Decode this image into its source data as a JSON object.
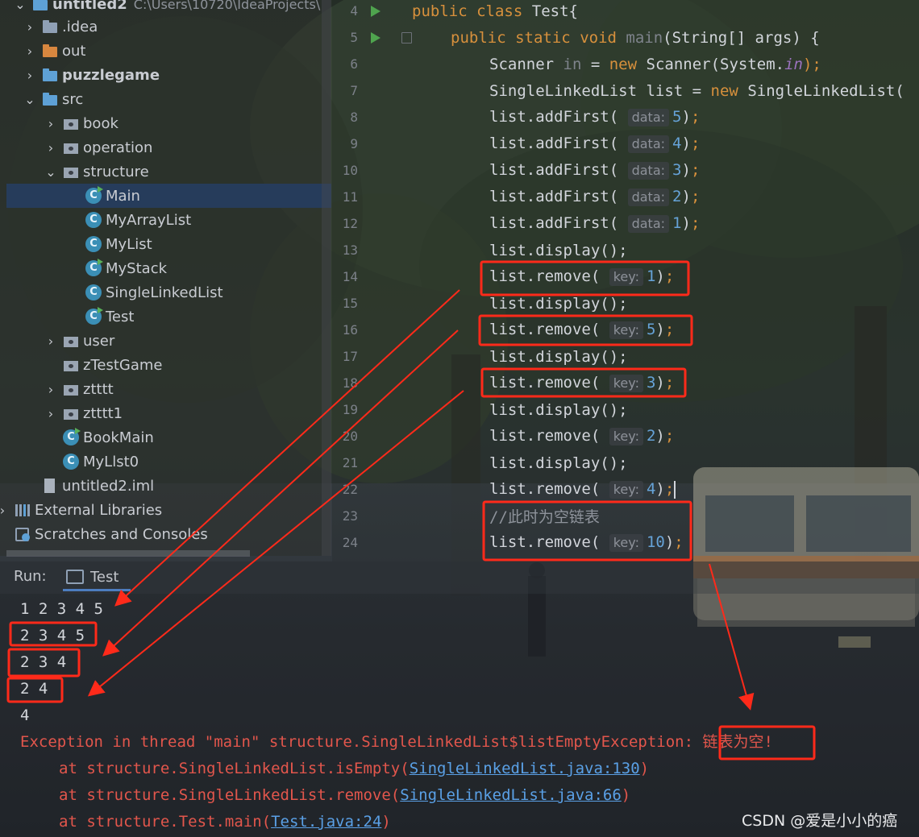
{
  "project_tree": {
    "root_name": "untitled2",
    "root_path": "C:\\Users\\10720\\IdeaProjects\\",
    "items": [
      {
        "label": ".idea",
        "icon": "folder-icon"
      },
      {
        "label": "out",
        "icon": "folder-orange-icon"
      },
      {
        "label": "puzzlegame",
        "icon": "module-folder-icon"
      },
      {
        "label": "src",
        "icon": "source-folder-icon"
      },
      {
        "label": "book",
        "icon": "package-icon"
      },
      {
        "label": "operation",
        "icon": "package-icon"
      },
      {
        "label": "structure",
        "icon": "package-icon"
      },
      {
        "label": "Main",
        "icon": "java-class-runnable-icon"
      },
      {
        "label": "MyArrayList",
        "icon": "java-class-icon"
      },
      {
        "label": "MyList",
        "icon": "java-class-icon"
      },
      {
        "label": "MyStack",
        "icon": "java-class-runnable-icon"
      },
      {
        "label": "SingleLinkedList",
        "icon": "java-class-icon"
      },
      {
        "label": "Test",
        "icon": "java-class-runnable-icon"
      },
      {
        "label": "user",
        "icon": "package-icon"
      },
      {
        "label": "zTestGame",
        "icon": "package-icon"
      },
      {
        "label": "ztttt",
        "icon": "package-icon"
      },
      {
        "label": "ztttt1",
        "icon": "package-icon"
      },
      {
        "label": "BookMain",
        "icon": "java-class-runnable-icon"
      },
      {
        "label": "MyLlst0",
        "icon": "java-class-icon"
      },
      {
        "label": "untitled2.iml",
        "icon": "module-file-icon"
      },
      {
        "label": "External Libraries",
        "icon": "libraries-icon"
      },
      {
        "label": "Scratches and Consoles",
        "icon": "scratches-icon"
      }
    ]
  },
  "editor": {
    "line_numbers": [
      "4",
      "5",
      "6",
      "7",
      "8",
      "9",
      "10",
      "11",
      "12",
      "13",
      "14",
      "15",
      "16",
      "17",
      "18",
      "19",
      "20",
      "21",
      "22",
      "23",
      "24"
    ],
    "tokens": {
      "public": "public",
      "class": "class",
      "class_name": "Test{",
      "static": "static",
      "void": "void",
      "main": "main",
      "main_params": "(String[] args) {",
      "scanner_type": "Scanner ",
      "in_var": "in",
      "eq": " = ",
      "new": "new",
      "scanner_ctor": " Scanner(System.",
      "in_field": "in",
      "close_semi": ");",
      "sll_decl": "SingleLinkedList list = ",
      "sll_ctor": " SingleLinkedList(",
      "add_first": "list.addFirst( ",
      "remove": "list.remove( ",
      "display": "list.display();",
      "hint_data": "data:",
      "hint_key": "key:",
      "close": ")",
      "semi": ";",
      "comment": "//此时为空链表"
    },
    "add_values": [
      "5",
      "4",
      "3",
      "2",
      "1"
    ],
    "remove_values": [
      "1",
      "5",
      "3",
      "2",
      "4",
      "10"
    ]
  },
  "run_panel": {
    "label": "Run:",
    "tab_label": "Test",
    "output": [
      "1 2 3 4 5",
      "2 3 4 5",
      "2 3 4",
      "2 4",
      "4"
    ],
    "exception": {
      "prefix": "Exception in thread \"main\" structure.SingleLinkedList$listEmptyException: ",
      "message": "链表为空!",
      "trace": [
        {
          "text": "at structure.SingleLinkedList.isEmpty(",
          "link": "SingleLinkedList.java:130",
          "end": ")"
        },
        {
          "text": "at structure.SingleLinkedList.remove(",
          "link": "SingleLinkedList.java:66",
          "end": ")"
        },
        {
          "text": "at structure.Test.main(",
          "link": "Test.java:24",
          "end": ")"
        }
      ]
    }
  },
  "watermark": "CSDN @爱是小小的癌",
  "colors": {
    "annotation_red": "#ff2a1a",
    "keyword": "#d7903c",
    "number": "#66a3d8",
    "error": "#e2564c",
    "link": "#5aa0e6"
  }
}
